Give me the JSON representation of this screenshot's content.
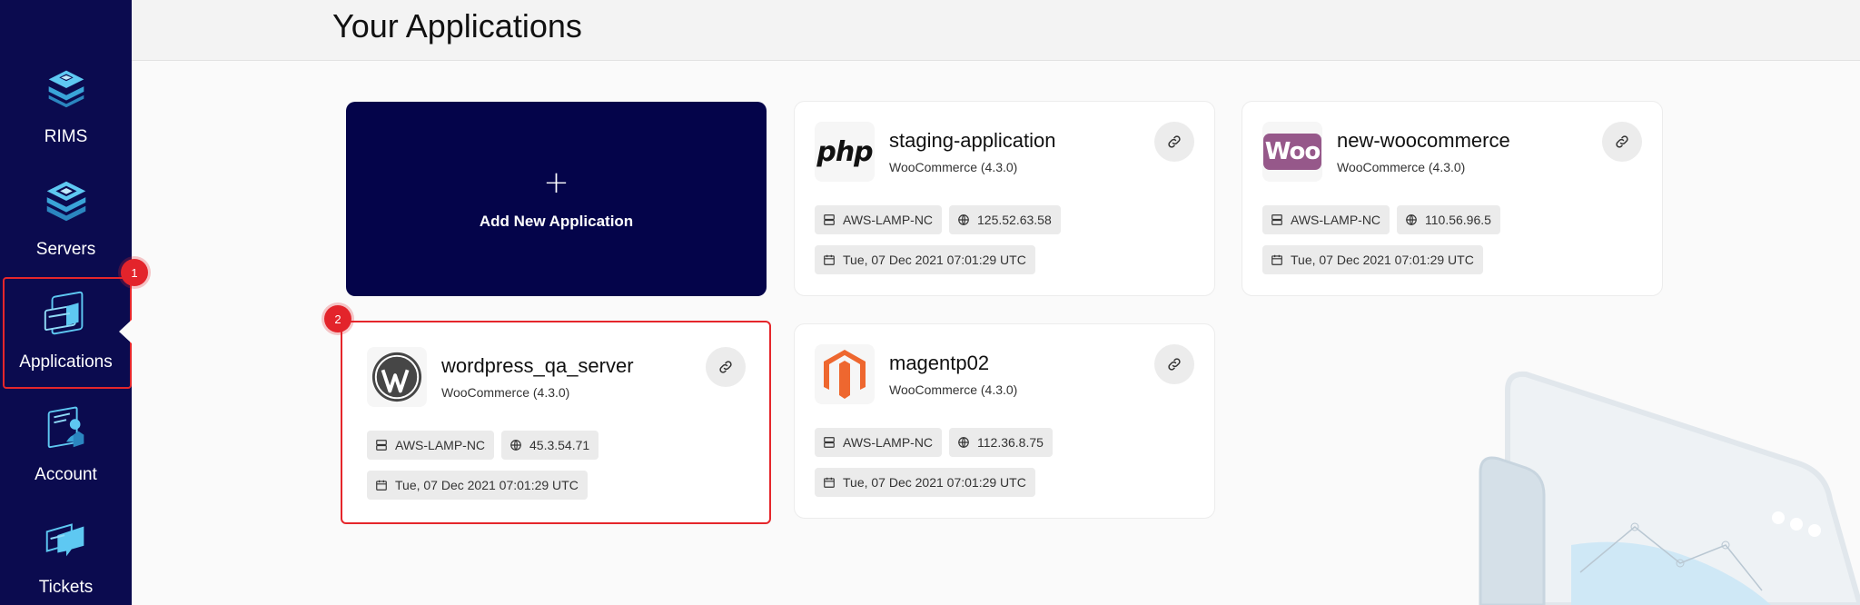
{
  "sidebar": {
    "items": [
      {
        "label": "RIMS",
        "icon": "rims-icon"
      },
      {
        "label": "Servers",
        "icon": "servers-icon"
      },
      {
        "label": "Applications",
        "icon": "applications-icon"
      },
      {
        "label": "Account",
        "icon": "account-icon"
      },
      {
        "label": "Tickets",
        "icon": "tickets-icon"
      }
    ],
    "active": "Applications"
  },
  "badges": {
    "step1": "1",
    "step2": "2"
  },
  "header": {
    "title": "Your Applications"
  },
  "add_card": {
    "plus": "+",
    "label": "Add New Application"
  },
  "logos": {
    "php": "php",
    "woo": "Woo"
  },
  "apps": [
    {
      "name": "staging-application",
      "type": "WooCommerce (4.3.0)",
      "server": "AWS-LAMP-NC",
      "ip": "125.52.63.58",
      "date": "Tue, 07 Dec 2021 07:01:29 UTC",
      "logo": "php-logo"
    },
    {
      "name": "new-woocommerce",
      "type": "WooCommerce (4.3.0)",
      "server": "AWS-LAMP-NC",
      "ip": "110.56.96.5",
      "date": "Tue, 07 Dec 2021 07:01:29 UTC",
      "logo": "woocommerce-logo"
    },
    {
      "name": "wordpress_qa_server",
      "type": "WooCommerce (4.3.0)",
      "server": "AWS-LAMP-NC",
      "ip": "45.3.54.71",
      "date": "Tue, 07 Dec 2021 07:01:29 UTC",
      "logo": "wordpress-logo"
    },
    {
      "name": "magentp02",
      "type": "WooCommerce (4.3.0)",
      "server": "AWS-LAMP-NC",
      "ip": "112.36.8.75",
      "date": "Tue, 07 Dec 2021 07:01:29 UTC",
      "logo": "magento-logo"
    }
  ],
  "colors": {
    "sidebar_bg": "#0b0b4f",
    "add_card_bg": "#04044a",
    "highlight": "#e5262b",
    "woo_purple": "#96588a",
    "magento_orange": "#ee672f"
  }
}
